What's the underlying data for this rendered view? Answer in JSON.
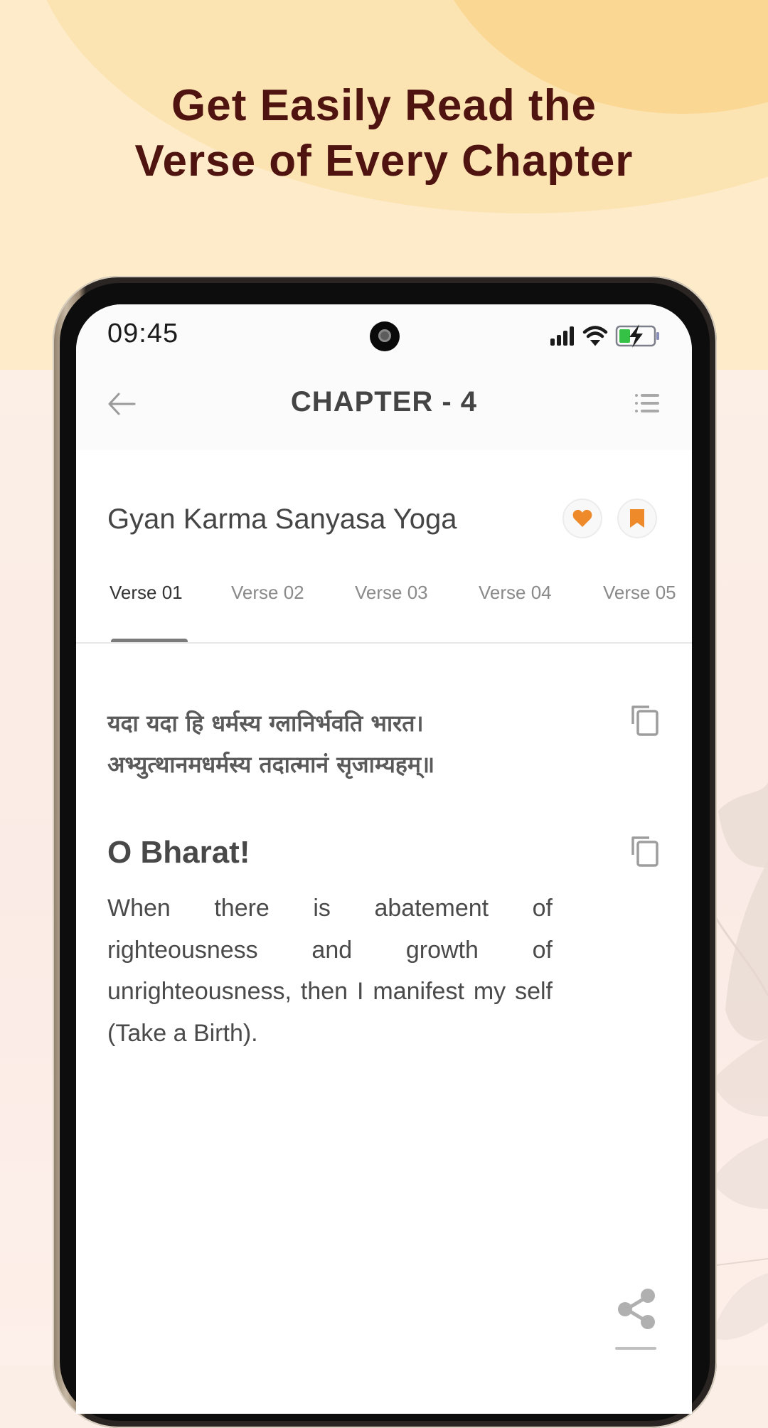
{
  "promo": {
    "headline_line1": "Get Easily Read the",
    "headline_line2": "Verse of Every Chapter"
  },
  "status_bar": {
    "time": "09:45",
    "icons": [
      "signal-icon",
      "wifi-icon",
      "battery-charging-icon"
    ]
  },
  "app_bar": {
    "back_icon": "arrow-left-icon",
    "title": "CHAPTER - 4",
    "menu_icon": "list-icon"
  },
  "chapter": {
    "name": "Gyan Karma Sanyasa Yoga",
    "favorite_icon": "heart-icon",
    "bookmark_icon": "bookmark-icon",
    "accent_color": "#ee8a2a"
  },
  "tabs": [
    {
      "label": "Verse 01",
      "active": true
    },
    {
      "label": "Verse 02",
      "active": false
    },
    {
      "label": "Verse 03",
      "active": false
    },
    {
      "label": "Verse 04",
      "active": false
    },
    {
      "label": "Verse 05",
      "active": false
    }
  ],
  "verse": {
    "sanskrit_line1": "यदा यदा हि धर्मस्य ग्लानिर्भवति भारत।",
    "sanskrit_line2": "अभ्युत्थानमधर्मस्य तदात्मानं सृजाम्यहम्॥",
    "copy_icon": "copy-icon",
    "translation_title": "O Bharat!",
    "translation_body": "When there is abatement of righteousness and growth of unrighteousness, then I manifest my self (Take a Birth)."
  },
  "footer": {
    "share_icon": "share-icon"
  }
}
